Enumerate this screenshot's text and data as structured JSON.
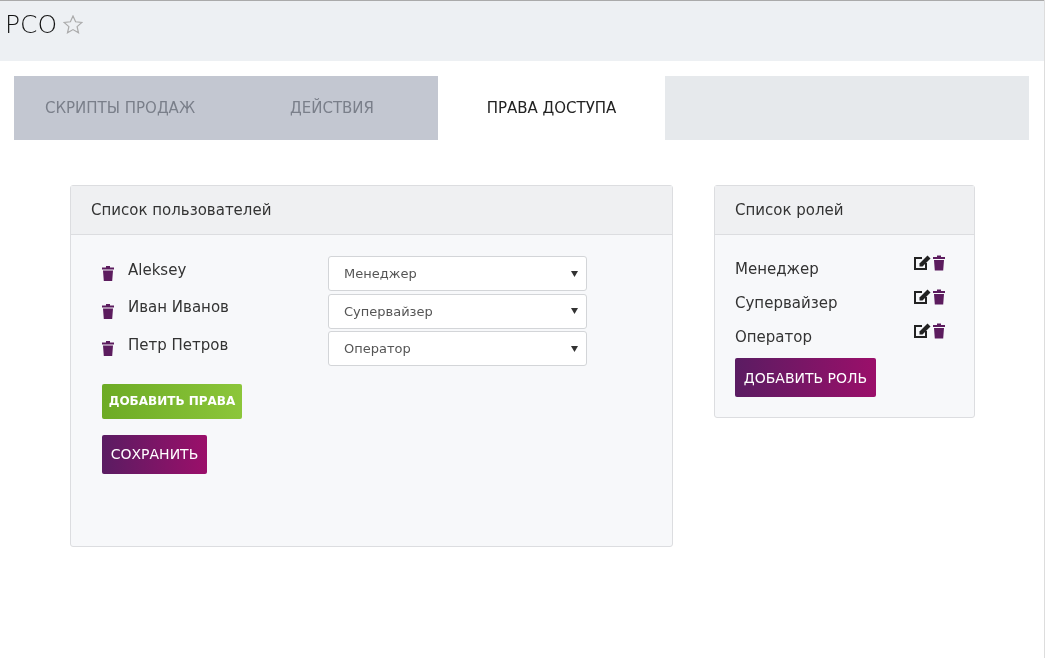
{
  "header": {
    "title": "РСО",
    "favorite": false
  },
  "tabs": [
    {
      "label": "СКРИПТЫ ПРОДАЖ",
      "selected": false
    },
    {
      "label": "ДЕЙСТВИЯ",
      "selected": false
    },
    {
      "label": "ПРАВА ДОСТУПА",
      "selected": true
    }
  ],
  "users_panel": {
    "title": "Список пользователей",
    "users": [
      {
        "name": "Aleksey",
        "role": "Менеджер"
      },
      {
        "name": "Иван Иванов",
        "role": "Супервайзер"
      },
      {
        "name": "Петр Петров",
        "role": "Оператор"
      }
    ],
    "add_button": "ДОБАВИТЬ ПРАВА",
    "save_button": "СОХРАНИТЬ"
  },
  "roles_panel": {
    "title": "Список ролей",
    "roles": [
      {
        "name": "Менеджер"
      },
      {
        "name": "Супервайзер"
      },
      {
        "name": "Оператор"
      }
    ],
    "add_button": "ДОБАВИТЬ РОЛЬ"
  }
}
